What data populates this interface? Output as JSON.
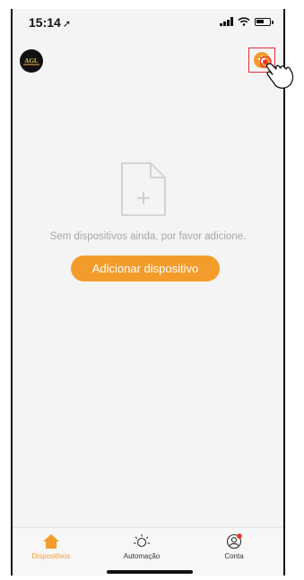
{
  "status_bar": {
    "time": "15:14",
    "location_glyph": "➚"
  },
  "header": {
    "logo_text": "AGL",
    "add_icon": "plus-circle-icon",
    "add_glyph": "+"
  },
  "empty_state": {
    "icon": "add-document-icon",
    "message": "Sem dispositivos ainda, por favor adicione.",
    "button_label": "Adicionar dispositivo"
  },
  "tabs": [
    {
      "label": "Dispositivos",
      "icon": "home-icon",
      "active": true
    },
    {
      "label": "Automação",
      "icon": "sun-icon",
      "active": false
    },
    {
      "label": "Conta",
      "icon": "account-icon",
      "active": false
    }
  ],
  "colors": {
    "accent": "#f39c2c",
    "highlight": "#e63030",
    "notification_dot": "#e63030"
  }
}
